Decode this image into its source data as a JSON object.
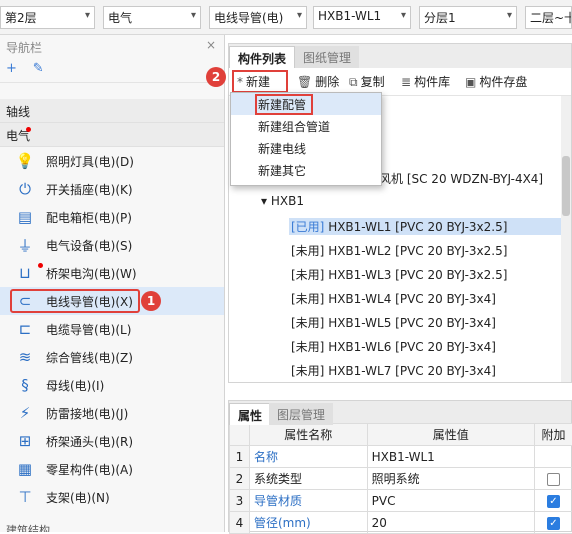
{
  "topbar": {
    "combos": [
      {
        "value": "第2层"
      },
      {
        "value": "电气"
      },
      {
        "value": "电线导管(电)"
      },
      {
        "value": "HXB1-WL1"
      },
      {
        "value": "分层1"
      },
      {
        "value": "二层~十"
      }
    ]
  },
  "left_panel": {
    "title": "导航栏",
    "close": "×",
    "tool_icons": [
      "+",
      "✎"
    ],
    "group_axis": "轴线",
    "group_electric": "电气",
    "items": [
      {
        "label": "照明灯具(电)(D)",
        "icon": "lightbulb-icon"
      },
      {
        "label": "开关插座(电)(K)",
        "icon": "switch-socket-icon"
      },
      {
        "label": "配电箱柜(电)(P)",
        "icon": "distribution-box-icon"
      },
      {
        "label": "电气设备(电)(S)",
        "icon": "plug-icon"
      },
      {
        "label": "桥架电沟(电)(W)",
        "icon": "tray-icon"
      },
      {
        "label": "电线导管(电)(X)",
        "icon": "conduit-icon"
      },
      {
        "label": "电缆导管(电)(L)",
        "icon": "cable-conduit-icon"
      },
      {
        "label": "综合管线(电)(Z)",
        "icon": "pipeline-icon"
      },
      {
        "label": "母线(电)(I)",
        "icon": "busbar-icon"
      },
      {
        "label": "防雷接地(电)(J)",
        "icon": "lightning-ground-icon"
      },
      {
        "label": "桥架通头(电)(R)",
        "icon": "tray-fitting-icon"
      },
      {
        "label": "零星构件(电)(A)",
        "icon": "grid-component-icon"
      },
      {
        "label": "支架(电)(N)",
        "icon": "bracket-icon"
      }
    ],
    "bottom_label": "建筑结构",
    "badge1": "1"
  },
  "component_panel": {
    "tab_active": "构件列表",
    "tab_inactive": "图纸管理",
    "badge2": "2",
    "toolbar": {
      "new": "新建",
      "delete": "删除",
      "copy": "复制",
      "library": "构件库",
      "save": "构件存盘"
    },
    "menu": [
      "新建配管",
      "新建组合管道",
      "新建电线",
      "新建其它"
    ],
    "tree": {
      "partial": "压风机 [SC 20 WDZN-BYJ-4X4]",
      "group": "HXB1",
      "rows": [
        {
          "tag": "[已用]",
          "text": " HXB1-WL1 [PVC 20 BYJ-3x2.5]"
        },
        {
          "tag": "[未用]",
          "text": " HXB1-WL2 [PVC 20 BYJ-3x2.5]"
        },
        {
          "tag": "[未用]",
          "text": " HXB1-WL3 [PVC 20 BYJ-3x2.5]"
        },
        {
          "tag": "[未用]",
          "text": " HXB1-WL4 [PVC 20 BYJ-3x4]"
        },
        {
          "tag": "[未用]",
          "text": " HXB1-WL5 [PVC 20 BYJ-3x4]"
        },
        {
          "tag": "[未用]",
          "text": " HXB1-WL6 [PVC 20 BYJ-3x4]"
        },
        {
          "tag": "[未用]",
          "text": " HXB1-WL7 [PVC 20 BYJ-3x4]"
        }
      ]
    }
  },
  "props_panel": {
    "tab_active": "属性",
    "tab_inactive": "图层管理",
    "headers": [
      "属性名称",
      "属性值",
      "附加"
    ],
    "rows": [
      {
        "num": "1",
        "name": "名称",
        "value": "HXB1-WL1",
        "checkbox": "none"
      },
      {
        "num": "2",
        "name": "系统类型",
        "value": "照明系统",
        "checkbox": "off"
      },
      {
        "num": "3",
        "name": "导管材质",
        "value": "PVC",
        "checkbox": "on"
      },
      {
        "num": "4",
        "name": "管径(mm)",
        "value": "20",
        "checkbox": "on"
      }
    ]
  },
  "colors": {
    "accent": "#2c6fc4",
    "highlight": "#e0403a",
    "selection": "#dce9f9"
  }
}
